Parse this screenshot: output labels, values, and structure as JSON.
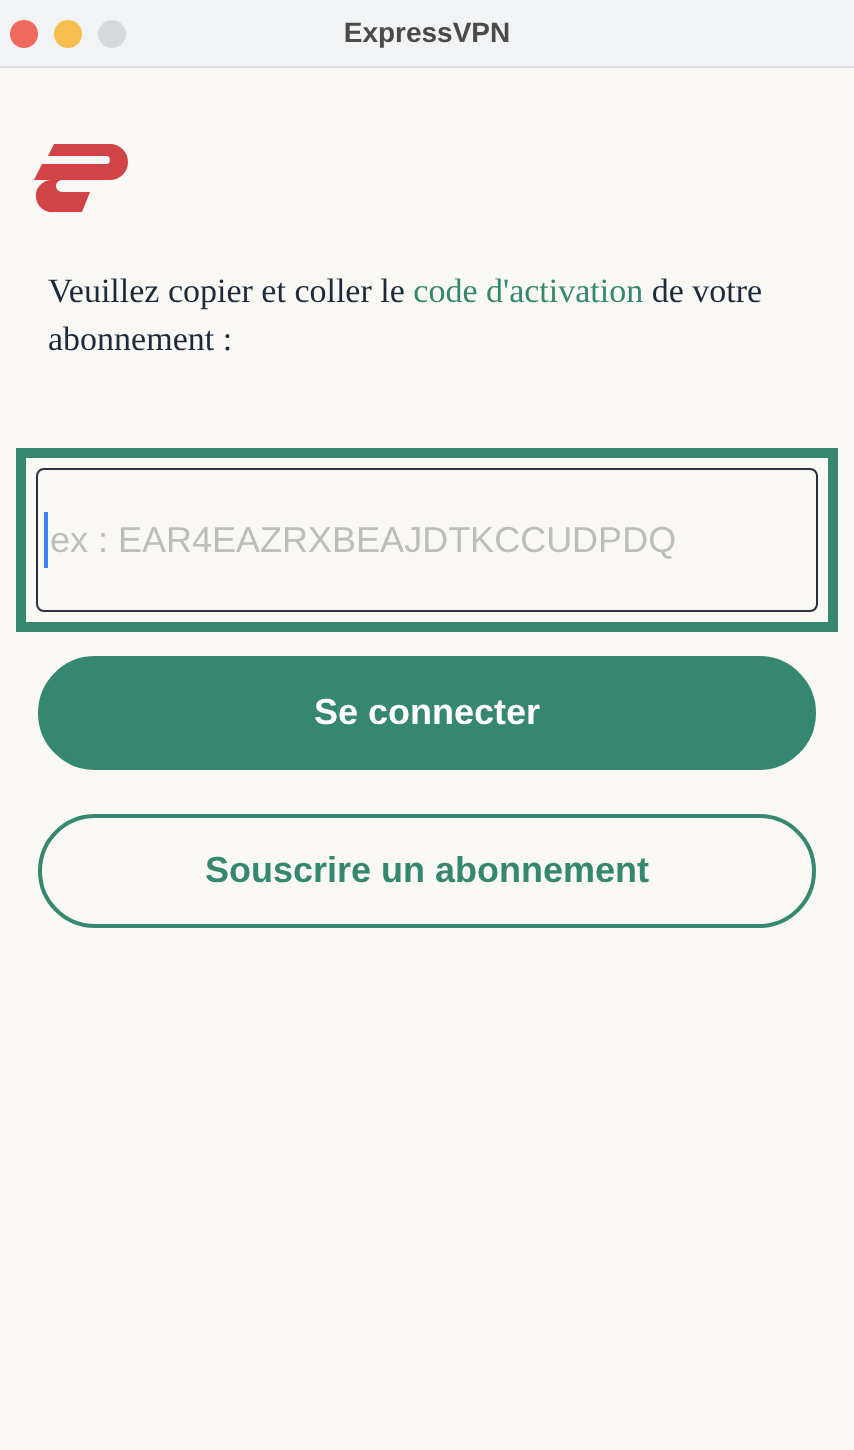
{
  "window": {
    "title": "ExpressVPN"
  },
  "instruction": {
    "before": "Veuillez copier et coller le",
    "link": "code d'activation",
    "after": "de votre abonnement :"
  },
  "activation_field": {
    "placeholder": "ex : EAR4EAZRXBEAJDTKCCUDPDQ",
    "focused": true
  },
  "buttons": [
    {
      "label": "Se connecter",
      "kind": "primary"
    },
    {
      "label": "Souscrire un abonnement",
      "kind": "secondary"
    }
  ]
}
